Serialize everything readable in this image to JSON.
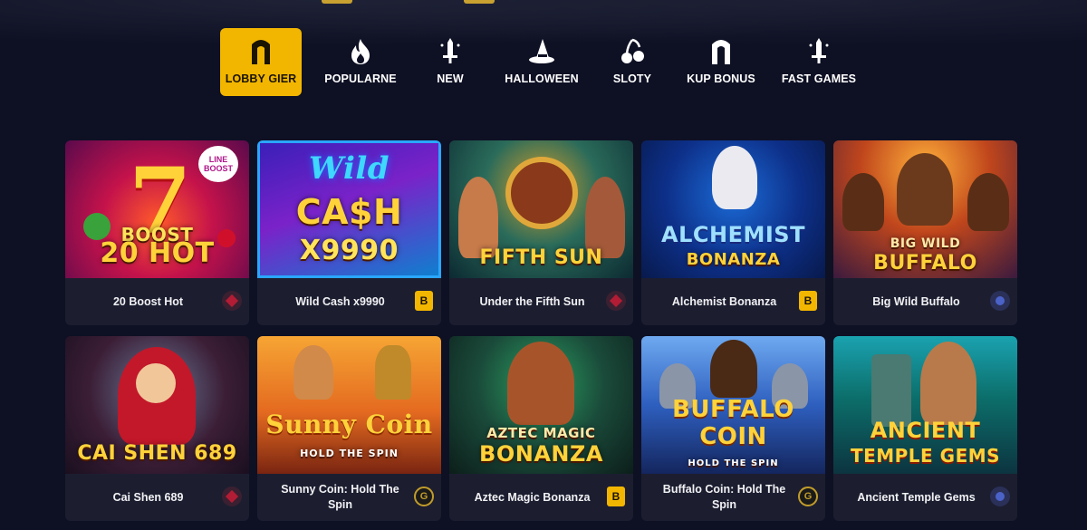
{
  "nav": {
    "items": [
      {
        "label": "LOBBY GIER",
        "icon": "arch-icon",
        "active": true
      },
      {
        "label": "POPULARNE",
        "icon": "flame-icon",
        "active": false
      },
      {
        "label": "NEW",
        "icon": "sword-icon",
        "active": false
      },
      {
        "label": "HALLOWEEN",
        "icon": "witch-hat-icon",
        "active": false
      },
      {
        "label": "SLOTY",
        "icon": "cherries-icon",
        "active": false
      },
      {
        "label": "KUP BONUS",
        "icon": "arch-icon",
        "active": false
      },
      {
        "label": "FAST GAMES",
        "icon": "sword-icon",
        "active": false
      }
    ]
  },
  "colors": {
    "accent": "#f2b600",
    "background": "#0e1024",
    "card": "#1c1e30"
  },
  "games": [
    {
      "name": "20 Boost Hot",
      "art_text": "20 HOT",
      "art_sub": "BOOST",
      "badge": "LINE BOOST",
      "provider": "red"
    },
    {
      "name": "Wild Cash x9990",
      "art_text": "CA$H",
      "art_sub": "X9990",
      "art_top": "Wild",
      "provider": "b"
    },
    {
      "name": "Under the Fifth Sun",
      "art_text": "FIFTH SUN",
      "provider": "red"
    },
    {
      "name": "Alchemist Bonanza",
      "art_text": "ALCHEMIST",
      "art_sub": "BONANZA",
      "provider": "b"
    },
    {
      "name": "Big Wild Buffalo",
      "art_text": "BUFFALO",
      "art_top": "BIG WILD",
      "provider": "blue"
    },
    {
      "name": "Cai Shen 689",
      "art_text": "CAI SHEN 689",
      "provider": "red"
    },
    {
      "name": "Sunny Coin: Hold The Spin",
      "art_text": "Sunny Coin",
      "art_sub": "HOLD THE SPIN",
      "provider": "g"
    },
    {
      "name": "Aztec Magic Bonanza",
      "art_text": "BONANZA",
      "art_top": "AZTEC MAGIC",
      "provider": "b"
    },
    {
      "name": "Buffalo Coin: Hold The Spin",
      "art_text": "BUFFALO COIN",
      "art_sub": "HOLD THE SPIN",
      "provider": "g"
    },
    {
      "name": "Ancient Temple Gems",
      "art_text": "ANCIENT",
      "art_sub": "TEMPLE GEMS",
      "provider": "blue"
    }
  ],
  "provider_labels": {
    "b": "B",
    "g": "G"
  }
}
